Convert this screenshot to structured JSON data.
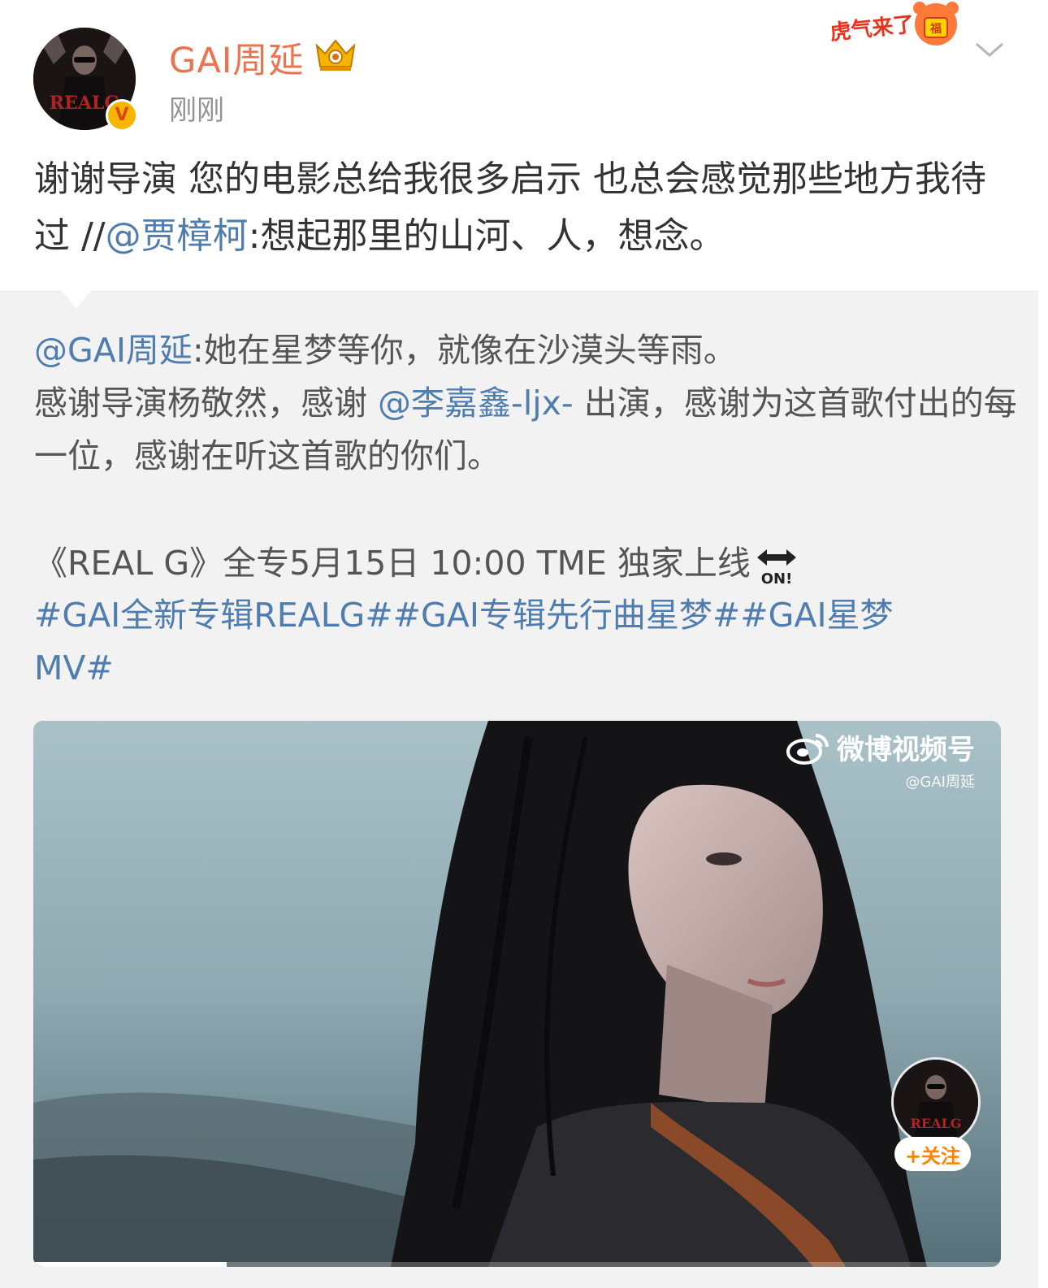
{
  "post": {
    "author": "GAI周延",
    "timestamp": "刚刚",
    "verified_glyph": "V",
    "text_before_mention": "谢谢导演 您的电影总给我很多启示 也总会感觉那些地方我待过 //",
    "mention": "@贾樟柯",
    "text_after_mention": ":想起那里的山河、人，想念。"
  },
  "repost": {
    "author_mention": "@GAI周延",
    "line1": ":她在星梦等你，就像在沙漠头等雨。",
    "line2_before": "感谢导演杨敬然，感谢 ",
    "line2_mention": "@李嘉鑫-ljx-",
    "line2_after": " 出演，感谢为这首歌付出的每一位，感谢在听这首歌的你们。",
    "album_line": "《REAL G》全专5月15日 10:00 TME 独家上线",
    "hashtags": [
      "#GAI全新专辑REALG#",
      "#GAI专辑先行曲星梦#",
      "#GAI星梦MV#"
    ]
  },
  "video": {
    "watermark_title": "微博视频号",
    "watermark_handle": "@GAI周延",
    "follow_label": "+关注",
    "progress": 0.2
  },
  "badges": {
    "tiger_text": "虎气来了",
    "avatar_text": "REALG",
    "on_text": "ON!"
  },
  "icons": {
    "crown": "crown-icon",
    "chevron": "chevron-down-icon",
    "verified": "verified-icon",
    "weibo": "weibo-logo-icon",
    "on": "on-arrow-icon"
  },
  "colors": {
    "username": "#eb7350",
    "link": "#507daf",
    "verified": "#f7b500",
    "follow": "#ff8200"
  }
}
